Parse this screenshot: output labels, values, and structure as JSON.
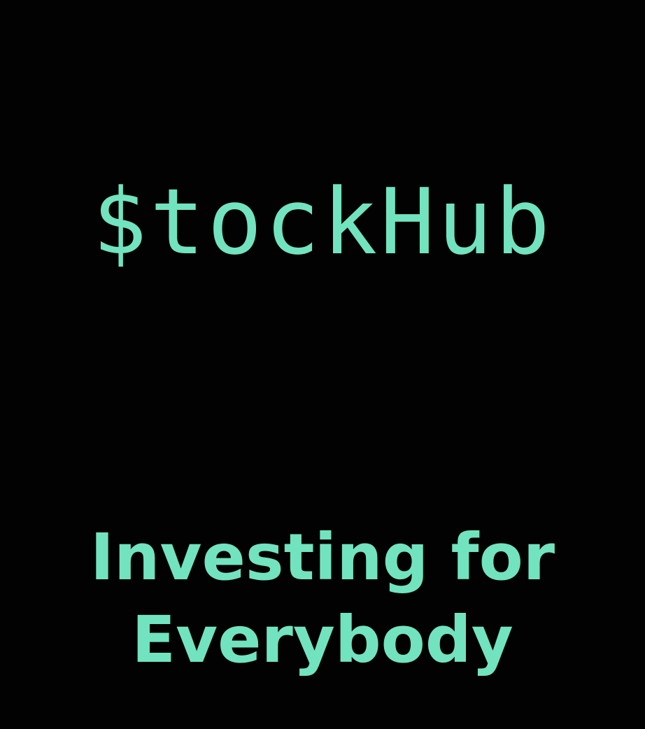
{
  "splash": {
    "logo_text": "$tockHub",
    "tagline_line1": "Investing for",
    "tagline_line2": "Everybody"
  },
  "colors": {
    "background": "#020202",
    "accent": "#72e3bf"
  }
}
